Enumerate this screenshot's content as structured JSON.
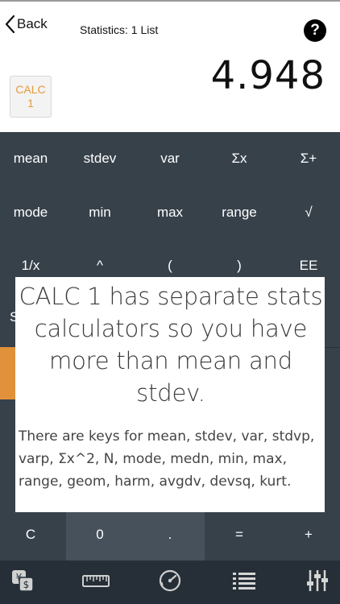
{
  "header": {
    "back_label": "Back",
    "title": "Statistics: 1 List",
    "help_label": "?"
  },
  "mode_button": {
    "line1": "CALC",
    "line2": "1"
  },
  "display": {
    "value": "4.948"
  },
  "keys": {
    "row1": [
      "mean",
      "stdev",
      "var",
      "Σx",
      "Σ+"
    ],
    "row2": [
      "mode",
      "min",
      "max",
      "range",
      "√"
    ],
    "row3": [
      "1/x",
      "^",
      "(",
      ")",
      "EE"
    ],
    "row_partial": "S",
    "bottom": [
      "C",
      "0",
      ".",
      "=",
      "+"
    ]
  },
  "overlay": {
    "headline": "CALC 1 has separate stats calculators so you have more than mean and stdev.",
    "body": "There are keys for mean, stdev, var, stdvp, varp, Σx^2, N, mode, medn, min, max, range, geom, harm, avgdv, devsq, kurt."
  },
  "tabs": [
    "currency-icon",
    "ruler-icon",
    "speedometer-icon",
    "list-icon",
    "sliders-icon"
  ],
  "colors": {
    "keypad_bg": "#37414a",
    "tabbar_bg": "#262f37",
    "accent_orange": "#e0913a",
    "mode_text": "#e29a3c"
  }
}
